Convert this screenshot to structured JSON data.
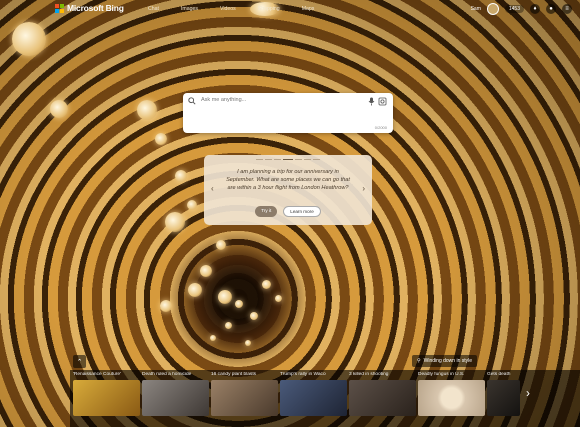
{
  "brand": {
    "name": "Microsoft Bing"
  },
  "nav": [
    "Chat",
    "Images",
    "Videos",
    "Shopping",
    "Maps"
  ],
  "header": {
    "user_name": "Sam",
    "points": "1453"
  },
  "search": {
    "placeholder": "Ask me anything...",
    "counter": "0/2000"
  },
  "copilot": {
    "prompt": "I am planning a trip for our anniversary in September. What are some places we can go that are within a 3 hour flight from London Heathrow?",
    "try_label": "Try it",
    "learn_label": "Learn more"
  },
  "image_caption": "Winding down in style",
  "news": [
    {
      "title": "'Renaissance Couture'",
      "color": "#c99a2e"
    },
    {
      "title": "Death ruled a homicide",
      "color": "#6e6660"
    },
    {
      "title": "16 candy plant blasts",
      "color": "#7a6450"
    },
    {
      "title": "Trump's rally in Waco",
      "color": "#3c4a66"
    },
    {
      "title": "3 killed in shooting",
      "color": "#4a3f38"
    },
    {
      "title": "Deadly fungus in U.S.",
      "color": "#d8c6ae"
    },
    {
      "title": "Gets death",
      "color": "#2a2622"
    }
  ]
}
